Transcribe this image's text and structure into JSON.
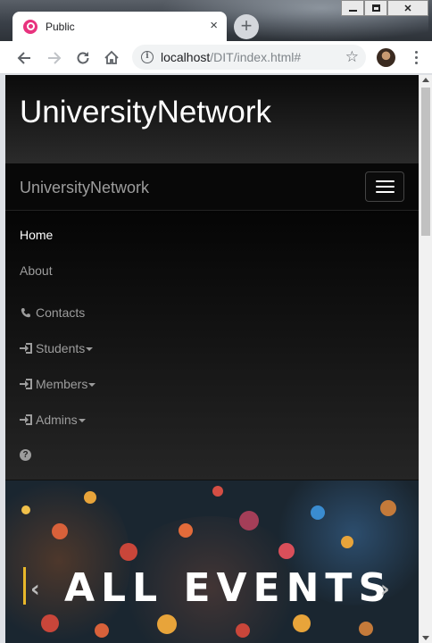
{
  "browser": {
    "tab_title": "Public",
    "tab_close": "×",
    "new_tab": "+",
    "url_host": "localhost",
    "url_path": "/DIT/index.html#",
    "info": "i",
    "bookmark": "☆"
  },
  "site": {
    "jumbotron_title": "UniversityNetwork",
    "brand": "UniversityNetwork"
  },
  "menu": {
    "home": "Home",
    "about": "About",
    "contacts": "Contacts",
    "students": "Students",
    "members": "Members",
    "admins": "Admins",
    "help": "?"
  },
  "banner": {
    "title": "ALL EVENTS",
    "prev": "‹",
    "next": "›"
  },
  "colors": {
    "navbar_bg": "#080808",
    "nav_text": "#9d9d9d",
    "active_text": "#ffffff",
    "banner_accent": "#e8b72a",
    "favicon": "#e8337e"
  }
}
